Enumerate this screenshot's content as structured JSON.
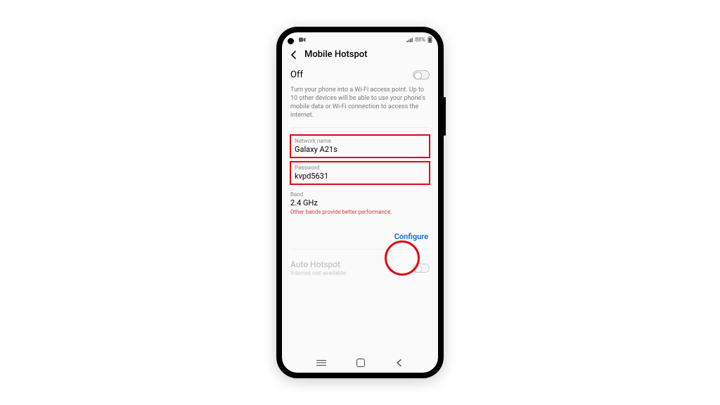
{
  "statusbar": {
    "battery_text": "88%"
  },
  "header": {
    "title": "Mobile Hotspot"
  },
  "toggle": {
    "state_label": "Off"
  },
  "description": "Turn your phone into a Wi-Fi access point. Up to 10 other devices will be able to use your phone's mobile data or Wi-Fi connection to access the internet.",
  "network_name": {
    "label": "Network name",
    "value": "Galaxy A21s"
  },
  "password": {
    "label": "Password",
    "value": "kvpd5631"
  },
  "band": {
    "label": "Band",
    "value": "2.4 GHz",
    "note": "Other bands provide better performance."
  },
  "configure": {
    "label": "Configure"
  },
  "auto_hotspot": {
    "title": "Auto Hotspot",
    "subtitle": "Internet not available"
  }
}
